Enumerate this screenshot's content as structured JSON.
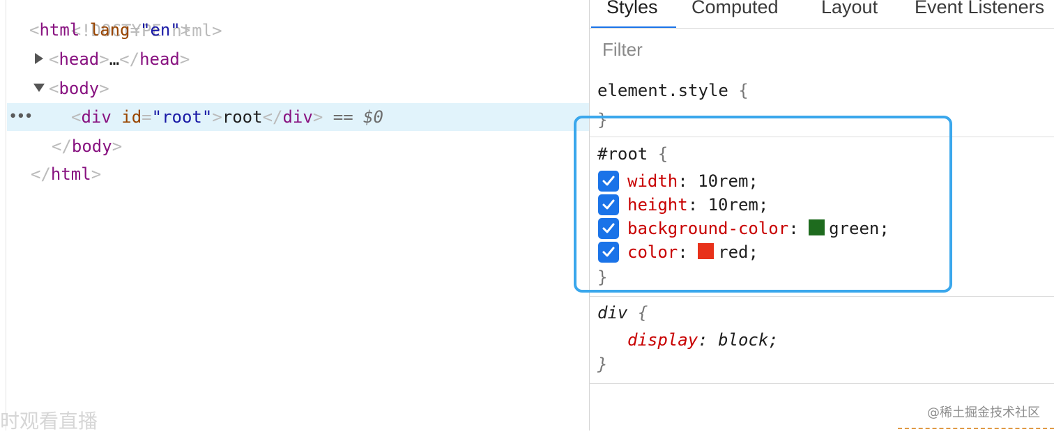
{
  "elements_panel": {
    "doctype": "<!DOCTYPE html>",
    "html_open": {
      "tag": "html",
      "attr_name": "lang",
      "attr_value": "\"en\""
    },
    "head_collapsed": {
      "open": "head",
      "ellipsis": "…",
      "close": "head"
    },
    "body_open": "body",
    "selected_node": {
      "tag": "div",
      "attr_name": "id",
      "attr_value": "\"root\"",
      "text": "root",
      "close": "div",
      "eq": "==",
      "ref": "$0"
    },
    "body_close": "body",
    "html_close": "html",
    "dots": "•••"
  },
  "styles_panel": {
    "tabs": [
      "Styles",
      "Computed",
      "Layout",
      "Event Listeners"
    ],
    "active_tab": "Styles",
    "filter_placeholder": "Filter",
    "rules": {
      "element_style": {
        "selector": "element.style",
        "open": "{",
        "close": "}"
      },
      "root": {
        "selector": "#root",
        "open": "{",
        "close": "}",
        "properties": [
          {
            "name": "width",
            "value": "10rem;",
            "checked": true
          },
          {
            "name": "height",
            "value": "10rem;",
            "checked": true
          },
          {
            "name": "background-color",
            "value": "green;",
            "checked": true,
            "swatch": "#1e6b1e"
          },
          {
            "name": "color",
            "value": "red;",
            "checked": true,
            "swatch": "#e8311a"
          }
        ]
      },
      "div": {
        "selector": "div",
        "open": "{",
        "close": "}",
        "properties": [
          {
            "name": "display",
            "value": "block;"
          }
        ]
      }
    }
  },
  "colors": {
    "accent": "#1a73e8",
    "highlight_box": "#3aa7ec",
    "selected_row": "#e1f3fb"
  },
  "watermarks": {
    "left": "时观看直播",
    "right": "@稀土掘金技术社区"
  }
}
